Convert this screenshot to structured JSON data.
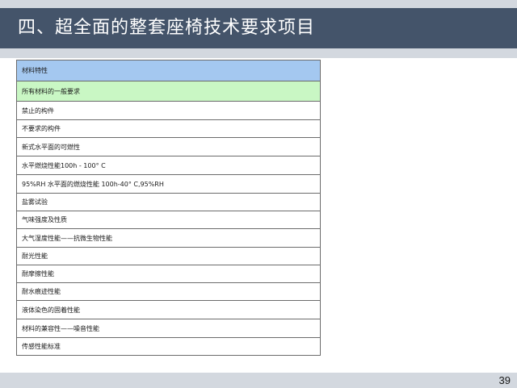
{
  "slide": {
    "title": "四、超全面的整套座椅技术要求项目",
    "page_number": "39"
  },
  "table": {
    "rows": [
      {
        "text": "材料特性",
        "style": "header"
      },
      {
        "text": "所有材料的一般要求",
        "style": "general"
      },
      {
        "text": "禁止的构件",
        "style": "tall"
      },
      {
        "text": "不要求的构件",
        "style": "short"
      },
      {
        "text": " 新式水平面的可燃性",
        "style": "tall"
      },
      {
        "text": "水平燃烧性能100h - 100° C",
        "style": "tall"
      },
      {
        "text": "95%RH 水平面的燃烧性能 100h-40° C,95%RH",
        "style": "tall"
      },
      {
        "text": "盐雾试验",
        "style": "short"
      },
      {
        "text": "气味强度及性质",
        "style": "short"
      },
      {
        "text": "大气湿度性能——抗微生物性能",
        "style": "tall"
      },
      {
        "text": "耐光性能",
        "style": "short"
      },
      {
        "text": "耐摩擦性能",
        "style": "short"
      },
      {
        "text": "耐水痕迹性能",
        "style": "short"
      },
      {
        "text": "液体染色的固着性能",
        "style": "tall"
      },
      {
        "text": "材料的兼容性——噪音性能",
        "style": "tall"
      },
      {
        "text": "传感性能标准",
        "style": "short"
      }
    ]
  },
  "colors": {
    "title_bar": "#44546a",
    "header_row": "#a4c8f0",
    "general_row": "#c9f7c4",
    "band": "#d3d8df"
  }
}
